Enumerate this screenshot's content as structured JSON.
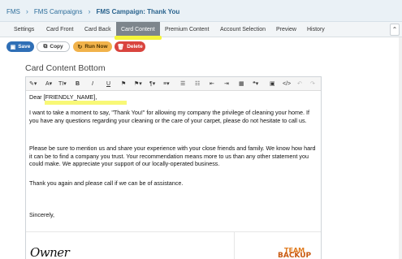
{
  "breadcrumb": {
    "items": [
      "FMS",
      "FMS Campaigns",
      "FMS Campaign: Thank You"
    ],
    "separator": "›"
  },
  "tabs": [
    {
      "label": "Settings",
      "active": false
    },
    {
      "label": "Card Front",
      "active": false
    },
    {
      "label": "Card Back",
      "active": false
    },
    {
      "label": "Card Content",
      "active": true
    },
    {
      "label": "Premium Content",
      "active": false
    },
    {
      "label": "Account Selection",
      "active": false
    },
    {
      "label": "Preview",
      "active": false
    },
    {
      "label": "History",
      "active": false
    }
  ],
  "tab_scroll_glyph": "⌃",
  "actions": {
    "save": "Save",
    "copy": "Copy",
    "run_now": "Run Now",
    "delete": "Delete"
  },
  "section_title": "Card Content Bottom",
  "toolbar": {
    "paint": "✎▾",
    "font": "A▾",
    "size": "TI▾",
    "bold": "B",
    "italic": "I",
    "underline": "U",
    "ink": "⚑",
    "brush": "⚑▾",
    "paragraph": "¶▾",
    "align": "≡▾",
    "ul": "☰",
    "ol": "☷",
    "outdent": "⇤",
    "indent": "⇥",
    "table": "▦",
    "quote": "❝▾",
    "image": "▣",
    "code": "</>",
    "undo": "↶",
    "redo": "↷"
  },
  "letter": {
    "greeting": "Dear [FRIENDLY_NAME],",
    "p1": "I want to take a moment to say, \"Thank You!\" for allowing my company the privilege of cleaning your home. If you have any questions regarding your cleaning or the care of your carpet, please do not hesitate to call us.",
    "p2": "Please be sure to mention us and share your experience with your close friends and family. We know how hard it can be to find a company you trust. Your recommendation means more to us than any other statement you could make. We appreciate your support of our locally-operated business.",
    "p3": "Thank you again and please call if we can be of assistance.",
    "closing": "Sincerely,"
  },
  "signature_text": "Owner",
  "logo_text": {
    "line1": "TEAM",
    "line2": "BACKUP"
  },
  "colors": {
    "save": "#2f6fb6",
    "run_now": "#f1b24a",
    "delete": "#d9443e",
    "active_tab": "#7d858c",
    "highlight": "#f5f53a"
  }
}
